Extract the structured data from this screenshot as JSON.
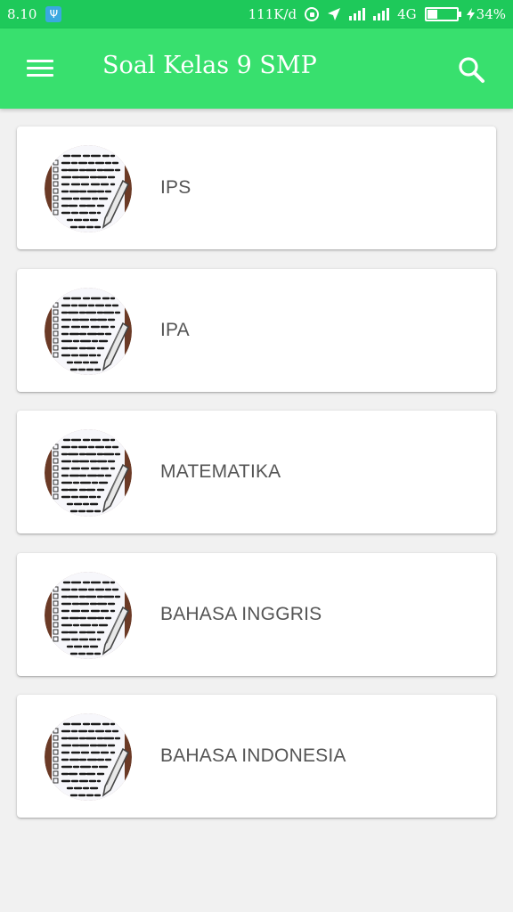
{
  "status_bar": {
    "time": "8.10",
    "usb_icon": "usb-icon",
    "network_speed": "111K/d",
    "network_type": "4G",
    "battery_percent": "34%",
    "battery_level": 0.34
  },
  "app_bar": {
    "title": "Soal Kelas 9 SMP",
    "menu_icon": "hamburger-menu-icon",
    "search_icon": "search-icon",
    "background_color": "#38e06e",
    "status_color": "#1ec95a"
  },
  "subjects": [
    {
      "label": "IPS"
    },
    {
      "label": "IPA"
    },
    {
      "label": "MATEMATIKA"
    },
    {
      "label": "BAHASA INGGRIS"
    },
    {
      "label": "BAHASA INDONESIA"
    }
  ]
}
